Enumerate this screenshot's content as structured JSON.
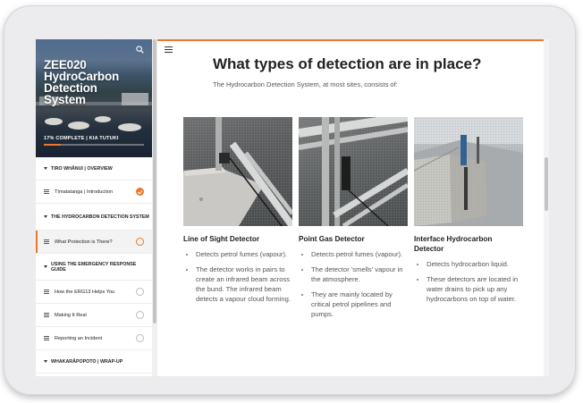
{
  "course": {
    "title": "ZEE020 HydroCarbon Detection System",
    "progress_text": "17% COMPLETE | KIA TUTUKI",
    "progress_fraction": 0.17
  },
  "sidebar": {
    "sections": [
      {
        "label": "TIRO WHĀNUI | OVERVIEW"
      },
      {
        "label": "THE HYDROCARBON DETECTION SYSTEM"
      },
      {
        "label": "USING THE EMERGENCY RESPONSE GUIDE"
      },
      {
        "label": "WHAKARĀPOPOTO | WRAP-UP"
      }
    ],
    "lessons": [
      {
        "label": "Tīmatatanga | Introduction",
        "status": "complete"
      },
      {
        "label": "What Protection is There?",
        "status": "current"
      },
      {
        "label": "How the ERG13 Helps You",
        "status": "incomplete"
      },
      {
        "label": "Making It Real",
        "status": "incomplete"
      },
      {
        "label": "Reporting an Incident",
        "status": "incomplete"
      }
    ]
  },
  "main": {
    "heading": "What types of detection are in place?",
    "intro": "The Hydrocarbon Detection System, at most sites, consists of:",
    "detectors": [
      {
        "title": "Line of Sight Detector",
        "bullets": [
          "Detects petrol fumes (vapour).",
          "The detector works in pairs to create an infrared beam across the bund. The infrared beam detects a vapour cloud forming."
        ]
      },
      {
        "title": "Point Gas Detector",
        "bullets": [
          "Detects petrol fumes (vapour).",
          "The detector 'smells' vapour in the atmosphere.",
          "They are mainly located by critical petrol pipelines and pumps."
        ]
      },
      {
        "title": "Interface Hydrocarbon Detector",
        "bullets": [
          "Detects hydrocarbon liquid.",
          "These detectors are located in water drains to pick up any hydrocarbons on top of water."
        ]
      }
    ]
  },
  "colors": {
    "accent": "#e8792d",
    "text": "#222222",
    "muted": "#555555"
  },
  "icons": {
    "search": "search-icon",
    "menu": "hamburger-menu-icon",
    "lesson": "document-icon"
  }
}
